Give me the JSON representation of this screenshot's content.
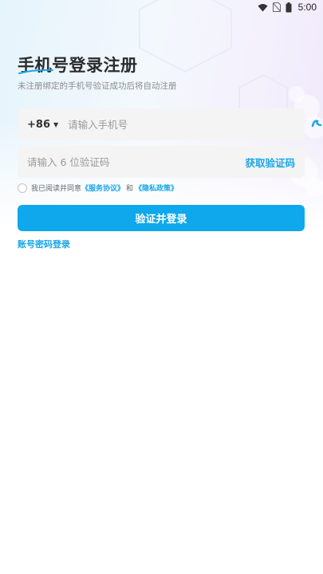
{
  "status_bar": {
    "time": "5:00",
    "icons": [
      "wifi-icon",
      "no-sim-icon",
      "battery-icon"
    ]
  },
  "header": {
    "title": "手机号登录注册",
    "subtitle": "未注册绑定的手机号验证成功后将自动注册"
  },
  "phone_field": {
    "country_code": "+86",
    "caret": "▼",
    "placeholder": "请输入手机号",
    "value": ""
  },
  "code_field": {
    "placeholder": "请输入 6 位验证码",
    "value": "",
    "get_code_label": "获取验证码"
  },
  "agreement": {
    "checked": false,
    "prefix": "我已阅读并同意",
    "service_link": "《服务协议》",
    "conjunction": "和",
    "privacy_link": "《隐私政策》"
  },
  "login_button": {
    "label": "验证并登录"
  },
  "password_login": {
    "label": "账号密码登录"
  },
  "colors": {
    "accent": "#0fa8ed",
    "link": "#1aa6e8",
    "title": "#2b2b2b",
    "subtitle": "#8d8d8d",
    "field_bg": "#f4f4f4"
  }
}
